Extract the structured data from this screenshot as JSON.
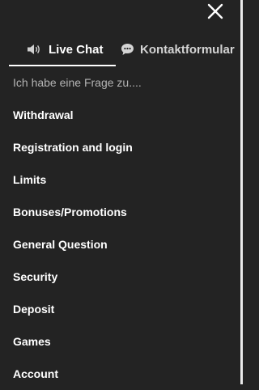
{
  "close_icon": "close-icon",
  "tabs": [
    {
      "label": "Live Chat",
      "icon": "speaker-icon",
      "active": true
    },
    {
      "label": "Kontaktformular",
      "icon": "chat-bubble-icon",
      "active": false
    }
  ],
  "prompt": "Ich habe eine Frage zu....",
  "topics": [
    {
      "label": "Withdrawal"
    },
    {
      "label": "Registration and login"
    },
    {
      "label": "Limits"
    },
    {
      "label": "Bonuses/Promotions"
    },
    {
      "label": "General Question"
    },
    {
      "label": "Security"
    },
    {
      "label": "Deposit"
    },
    {
      "label": "Games"
    },
    {
      "label": "Account"
    }
  ],
  "colors": {
    "background": "#232323",
    "text": "#ffffff",
    "muted_text": "#b4b4b4",
    "underline": "#ffffff"
  }
}
